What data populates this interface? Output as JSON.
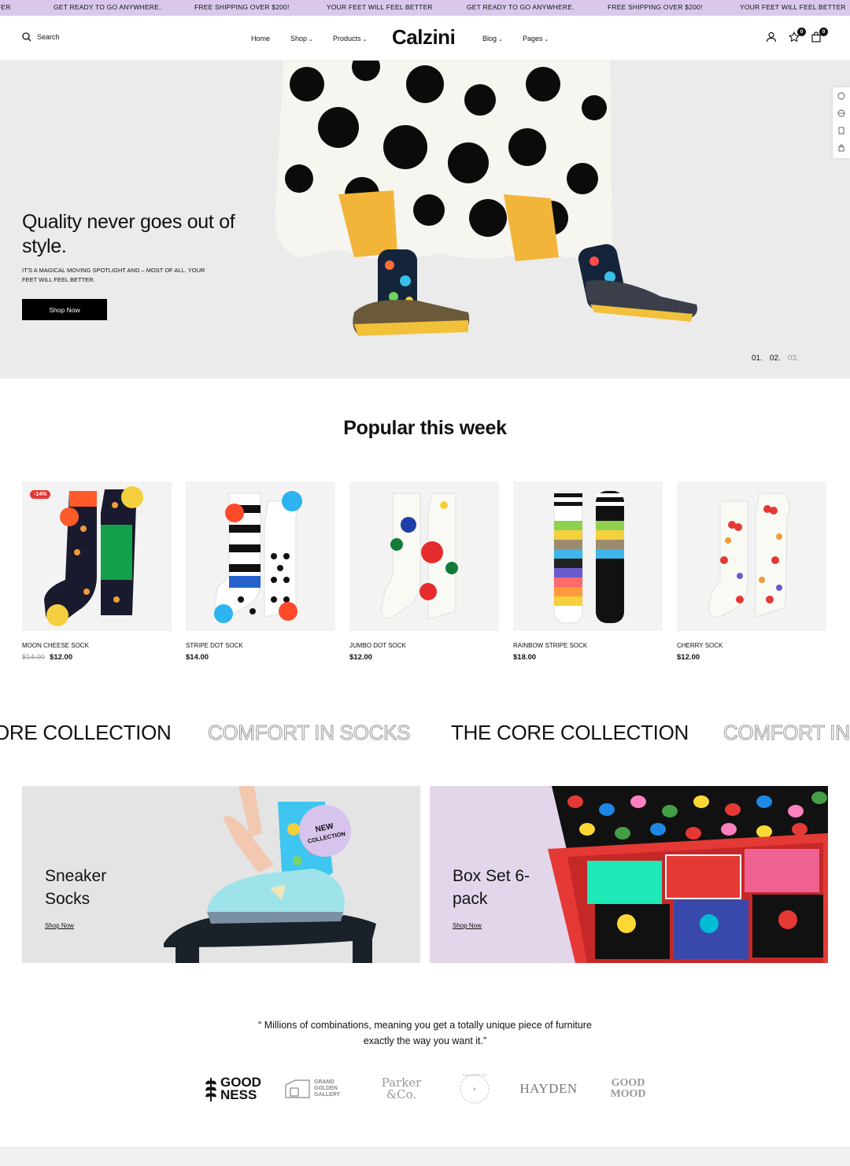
{
  "announcement": {
    "items": [
      "FER",
      "GET READY TO GO ANYWHERE.",
      "FREE SHIPPING OVER $200!",
      "YOUR FEET WILL FEEL BETTER",
      "GET READY TO GO ANYWHERE.",
      "FREE SHIPPING OVER $200!",
      "YOUR FEET WILL FEEL BETTER"
    ]
  },
  "header": {
    "search_label": "Search",
    "nav": [
      "Home",
      "Shop",
      "Products",
      "Blog",
      "Pages"
    ],
    "logo": "Calzini",
    "wishlist_count": "0",
    "cart_count": "0"
  },
  "hero": {
    "title": "Quality never goes out of style.",
    "subtitle": "It's a magical moving spotlight and – most of all. Your feet will feel better.",
    "cta": "Shop Now",
    "slides": [
      "01.",
      "02.",
      "03."
    ]
  },
  "popular": {
    "title": "Popular this week",
    "products": [
      {
        "name": "MOON CHEESE SOCK",
        "old_price": "$14.00",
        "price": "$12.00",
        "badge": "-14%"
      },
      {
        "name": "STRIPE DOT SOCK",
        "price": "$14.00"
      },
      {
        "name": "JUMBO DOT SOCK",
        "price": "$12.00"
      },
      {
        "name": "RAINBOW STRIPE SOCK",
        "price": "$18.00"
      },
      {
        "name": "CHERRY SOCK",
        "price": "$12.00"
      }
    ]
  },
  "marquee": [
    "ORE COLLECTION",
    "COMFORT IN SOCKS",
    "THE CORE COLLECTION",
    "COMFORT IN S"
  ],
  "promos": [
    {
      "title": "Sneaker Socks",
      "link": "Shop Now",
      "sticker": "NEW COLLECTION"
    },
    {
      "title": "Box Set 6-pack",
      "link": "Shop Now"
    }
  ],
  "testimonial": {
    "quote": "“ Millions of combinations, meaning you get a totally unique piece of furniture exactly the way you want it.”"
  },
  "brands": [
    {
      "name": "GOOD NESS",
      "icon": "wheat-icon"
    },
    {
      "name": "GRAND GOLDEN GALLERY",
      "icon": "frame-icon"
    },
    {
      "name": "Parker &Co."
    },
    {
      "name": "THE BEST OF",
      "icon": "circle-seal-icon"
    },
    {
      "name": "HAYDEN"
    },
    {
      "name": "GOOD MOOD"
    }
  ],
  "colors": {
    "announcement_bg": "#d9c8ec",
    "hero_bg": "#ebebeb",
    "sale_badge": "#e53935",
    "promo_left_bg": "#e4e4e4",
    "promo_right_bg": "#e3d6ea"
  }
}
